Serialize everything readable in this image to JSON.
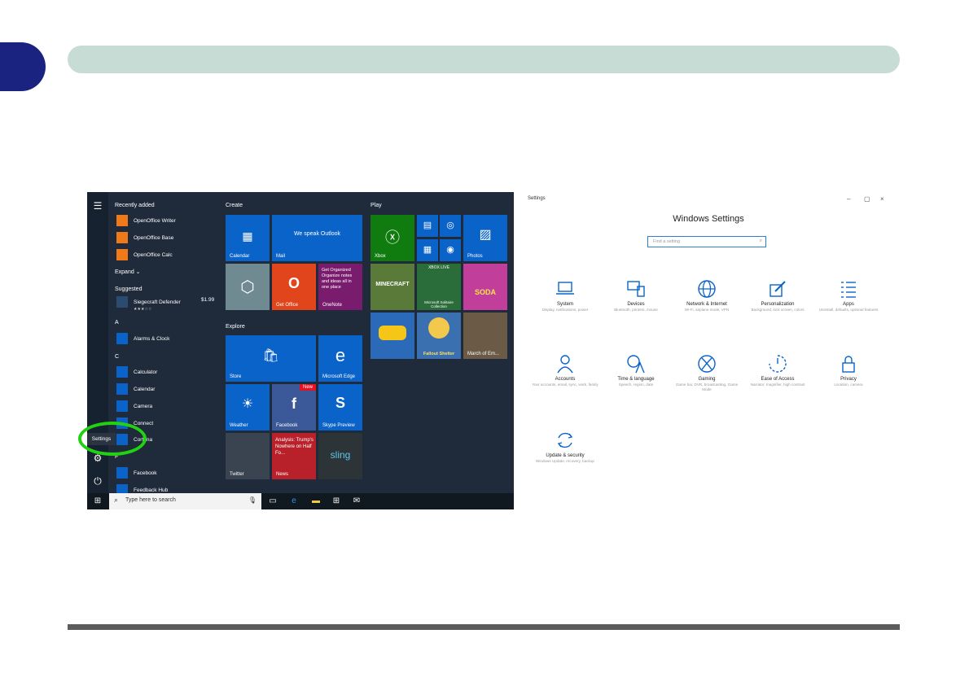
{
  "page": {
    "header_bar_color": "#c6dcd5",
    "tab_color": "#1a2480"
  },
  "start_menu": {
    "sections": {
      "recently_added": "Recently added",
      "expand": "Expand ⌄",
      "suggested": "Suggested",
      "a": "A",
      "c": "C",
      "f": "F"
    },
    "apps": {
      "openoffice_writer": "OpenOffice Writer",
      "openoffice_base": "OpenOffice Base",
      "openoffice_calc": "OpenOffice Calc",
      "siegecraft": "Siegecraft Defender",
      "alarms": "Alarms & Clock",
      "calculator": "Calculator",
      "calendar": "Calendar",
      "camera": "Camera",
      "connect": "Connect",
      "cortana": "Cortana",
      "facebook": "Facebook",
      "feedback": "Feedback Hub"
    },
    "suggested_price": "$1.99",
    "stars": "★★★☆☆",
    "settings_tooltip": "Settings",
    "groups": {
      "create": "Create",
      "explore": "Explore",
      "play": "Play"
    },
    "tiles": {
      "calendar": "Calendar",
      "mail_caption": "We speak Outlook",
      "mail": "Mail",
      "get_office": "Get Office",
      "onenote_text": "Get Organized Organize notes and ideas all in one place",
      "onenote": "OneNote",
      "store": "Store",
      "edge": "Microsoft Edge",
      "weather": "Weather",
      "facebook": "Facebook",
      "facebook_badge": "New",
      "skype": "Skype Preview",
      "twitter": "Twitter",
      "news_text": "Analysis: Trump's Nowhere on Half Fo...",
      "news": "News",
      "sling": "sling",
      "xbox": "Xbox",
      "photos": "Photos",
      "minecraft": "MINECRAFT",
      "xbox_live": "XBOX LIVE",
      "solitaire": "Microsoft Solitaire Collection",
      "candy": "SODA",
      "fallout": "Fallout Shelter",
      "march": "March of Em..."
    },
    "taskbar": {
      "search_placeholder": "Type here to search"
    }
  },
  "settings_window": {
    "title": "Settings",
    "heading": "Windows Settings",
    "search_placeholder": "Find a setting",
    "categories": [
      {
        "name": "System",
        "desc": "Display, notifications, power",
        "icon": "laptop-icon"
      },
      {
        "name": "Devices",
        "desc": "Bluetooth, printers, mouse",
        "icon": "keyboard-icon"
      },
      {
        "name": "Network & Internet",
        "desc": "Wi-Fi, airplane mode, VPN",
        "icon": "globe-icon"
      },
      {
        "name": "Personalization",
        "desc": "Background, lock screen, colors",
        "icon": "paintbrush-icon"
      },
      {
        "name": "Apps",
        "desc": "Uninstall, defaults, optional features",
        "icon": "list-icon"
      },
      {
        "name": "Accounts",
        "desc": "Your accounts, email, sync, work, family",
        "icon": "person-icon"
      },
      {
        "name": "Time & language",
        "desc": "Speech, region, date",
        "icon": "time-language-icon"
      },
      {
        "name": "Gaming",
        "desc": "Game bar, DVR, broadcasting, Game Mode",
        "icon": "xbox-icon"
      },
      {
        "name": "Ease of Access",
        "desc": "Narrator, magnifier, high contrast",
        "icon": "ease-of-access-icon"
      },
      {
        "name": "Privacy",
        "desc": "Location, camera",
        "icon": "lock-icon"
      },
      {
        "name": "Update & security",
        "desc": "Windows Update, recovery, backup",
        "icon": "sync-icon"
      }
    ]
  }
}
